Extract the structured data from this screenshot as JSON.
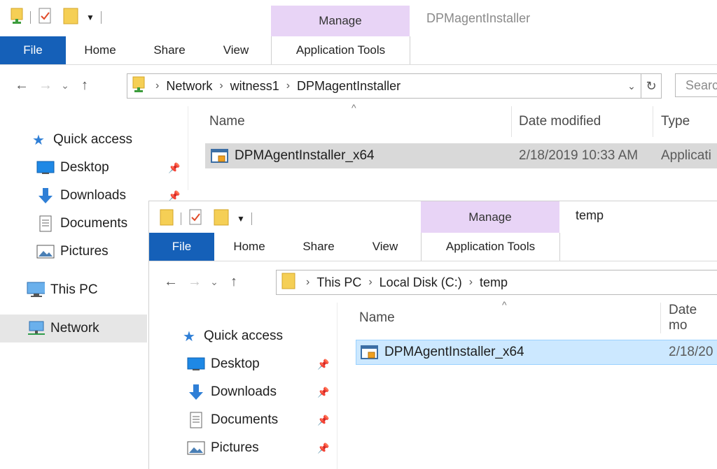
{
  "window_back": {
    "title": "DPMagentInstaller",
    "manage_label": "Manage",
    "tabs": [
      "File",
      "Home",
      "Share",
      "View",
      "Application Tools"
    ],
    "address": [
      "Network",
      "witness1",
      "DPMagentInstaller"
    ],
    "search_placeholder": "Search",
    "columns": [
      "Name",
      "Date modified",
      "Type"
    ],
    "file": {
      "name": "DPMAgentInstaller_x64",
      "date": "2/18/2019 10:33 AM",
      "type": "Applicati"
    },
    "nav": {
      "quick_access": "Quick access",
      "items": [
        "Desktop",
        "Downloads",
        "Documents",
        "Pictures"
      ],
      "this_pc": "This PC",
      "network": "Network"
    }
  },
  "window_front": {
    "title": "temp",
    "manage_label": "Manage",
    "tabs": [
      "File",
      "Home",
      "Share",
      "View",
      "Application Tools"
    ],
    "address": [
      "This PC",
      "Local Disk (C:)",
      "temp"
    ],
    "columns": [
      "Name",
      "Date mo"
    ],
    "file": {
      "name": "DPMAgentInstaller_x64",
      "date": "2/18/20"
    },
    "nav": {
      "quick_access": "Quick access",
      "items": [
        "Desktop",
        "Downloads",
        "Documents",
        "Pictures"
      ]
    }
  },
  "colors": {
    "file_tab": "#1560b8",
    "manage": "#e8d4f6",
    "selected_row": "#cce8ff",
    "hover_row": "#d9d9d9"
  }
}
